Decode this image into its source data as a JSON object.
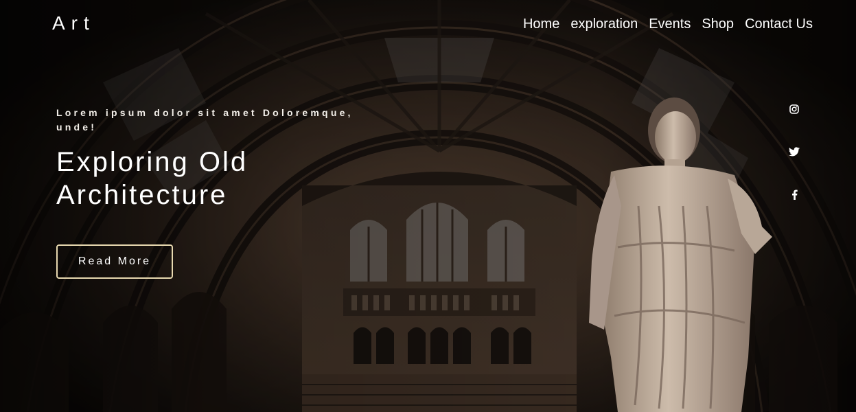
{
  "brand": {
    "logo_text": "Art"
  },
  "nav": {
    "items": [
      {
        "label": "Home"
      },
      {
        "label": "exploration"
      },
      {
        "label": "Events"
      },
      {
        "label": "Shop"
      },
      {
        "label": "Contact Us"
      }
    ]
  },
  "hero": {
    "eyebrow": "Lorem ipsum dolor sit amet Doloremque, unde!",
    "title_line1": "Exploring Old",
    "title_line2": "Architecture",
    "cta_label": "Read More"
  },
  "social": {
    "icons": [
      "instagram-icon",
      "twitter-icon",
      "facebook-icon"
    ]
  },
  "colors": {
    "button_border": "#e8d9b0",
    "background_dark": "#1a1410",
    "stone": "#b9a795"
  }
}
